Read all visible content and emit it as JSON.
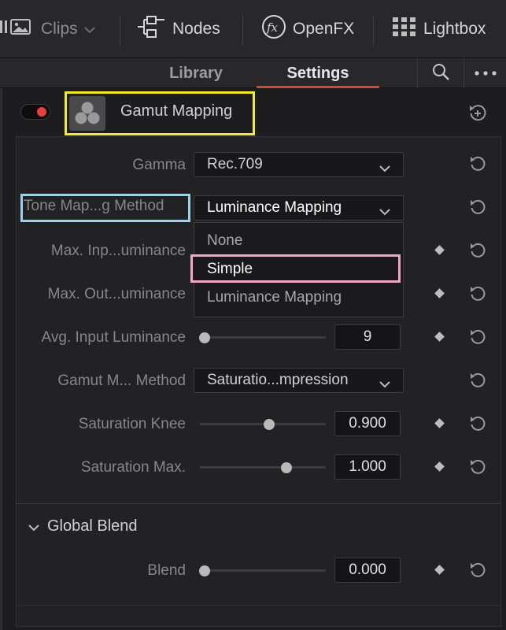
{
  "toolbar": {
    "clips_label": "Clips",
    "nodes_label": "Nodes",
    "openfx_label": "OpenFX",
    "lightbox_label": "Lightbox"
  },
  "tabs": {
    "library": "Library",
    "settings": "Settings"
  },
  "effect": {
    "title": "Gamut Mapping",
    "enabled": true,
    "toggle_color": "#e8403a"
  },
  "settings": {
    "gamma": {
      "label": "Gamma",
      "value": "Rec.709"
    },
    "tone_mapping_method": {
      "label": "Tone Map...g Method",
      "value": "Luminance Mapping",
      "options": [
        "None",
        "Simple",
        "Luminance Mapping"
      ],
      "highlighted_option": "Simple"
    },
    "max_input_luminance": {
      "label": "Max. Inp...uminance"
    },
    "max_output_luminance": {
      "label": "Max. Out...uminance"
    },
    "avg_input_luminance": {
      "label": "Avg. Input Luminance",
      "value": "9",
      "slider": 0.0
    },
    "gamut_mapping_method": {
      "label": "Gamut M... Method",
      "value": "Saturatio...mpression"
    },
    "saturation_knee": {
      "label": "Saturation Knee",
      "value": "0.900",
      "slider": 0.56
    },
    "saturation_max": {
      "label": "Saturation Max.",
      "value": "1.000",
      "slider": 0.71
    }
  },
  "global_blend": {
    "title": "Global Blend",
    "blend": {
      "label": "Blend",
      "value": "0.000",
      "slider": 0.0
    }
  },
  "colors": {
    "accent": "#d0473c",
    "annotation_yellow": "#f2ea2f",
    "annotation_blue": "#9ed0e6",
    "annotation_pink": "#f0a8c4"
  },
  "icons": [
    "clips-icon",
    "nodes-icon",
    "openfx-icon",
    "lightbox-icon",
    "search-icon",
    "more-icon",
    "reset-icon",
    "keyframe-diamond-icon",
    "chevron-down-icon"
  ]
}
